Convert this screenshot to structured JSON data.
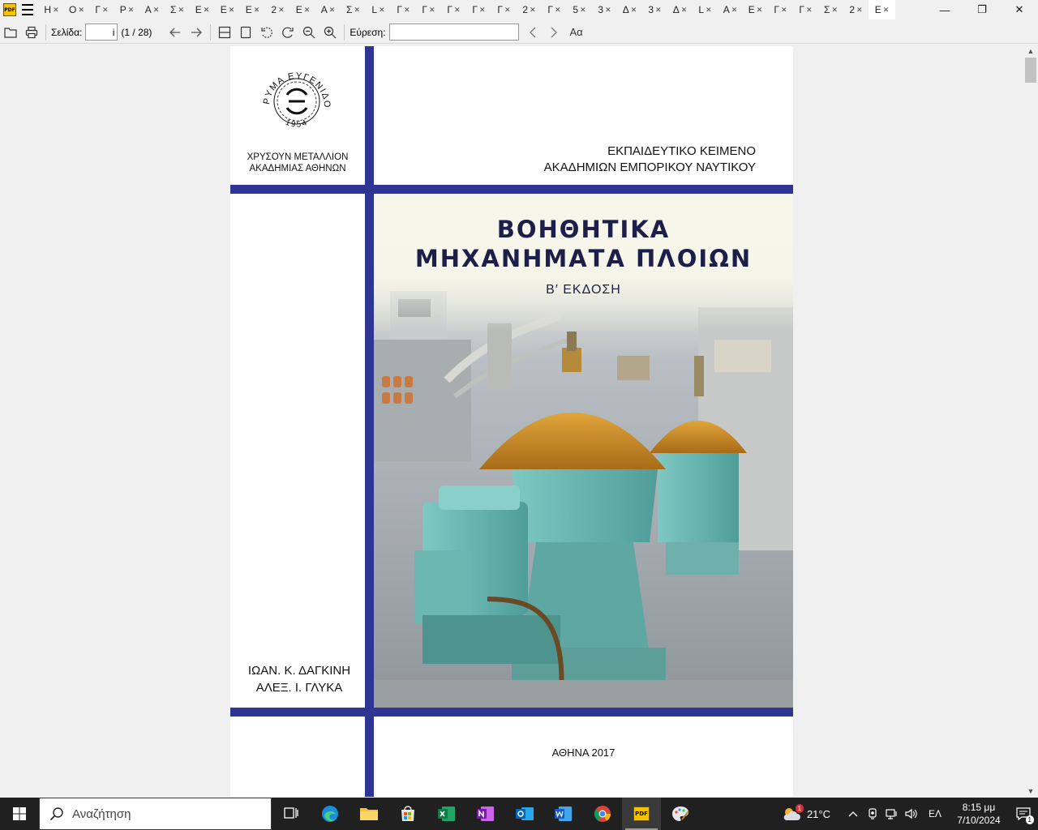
{
  "app": {
    "icon_text": "PDF",
    "tabs": [
      {
        "label": "Η"
      },
      {
        "label": "Ο"
      },
      {
        "label": "Γ"
      },
      {
        "label": "Ρ"
      },
      {
        "label": "Α"
      },
      {
        "label": "Σ"
      },
      {
        "label": "Ε"
      },
      {
        "label": "Ε"
      },
      {
        "label": "Ε"
      },
      {
        "label": "2"
      },
      {
        "label": "Ε"
      },
      {
        "label": "Α"
      },
      {
        "label": "Σ"
      },
      {
        "label": "L"
      },
      {
        "label": "Γ"
      },
      {
        "label": "Γ"
      },
      {
        "label": "Γ"
      },
      {
        "label": "Γ"
      },
      {
        "label": "Γ"
      },
      {
        "label": "2"
      },
      {
        "label": "Γ"
      },
      {
        "label": "5"
      },
      {
        "label": "3"
      },
      {
        "label": "Δ"
      },
      {
        "label": "3"
      },
      {
        "label": "Δ"
      },
      {
        "label": "L"
      },
      {
        "label": "Α"
      },
      {
        "label": "Ε"
      },
      {
        "label": "Γ"
      },
      {
        "label": "Γ"
      },
      {
        "label": "Σ"
      },
      {
        "label": "2"
      }
    ],
    "active_tab": {
      "label": "Ε"
    },
    "tab_close_glyph": "✕"
  },
  "window_controls": {
    "minimize": "—",
    "maximize": "❐",
    "close": "✕"
  },
  "toolbar": {
    "page_label": "Σελίδα:",
    "page_value": "i",
    "page_count": "(1 / 28)",
    "find_label": "Εύρεση:",
    "find_value": "",
    "case_label": "Aα"
  },
  "document": {
    "seal_text_top": "ΙΔΡΥΜΑ ΕΥΓΕΝΙΔΟΥ",
    "seal_year": "1954",
    "award_line1": "ΧΡΥΣΟΥΝ ΜΕΤΑΛΛΙΟΝ",
    "award_line2": "ΑΚΑΔΗΜΙΑΣ ΑΘΗΝΩΝ",
    "edu_line1": "ΕΚΠΑΙΔΕΥΤΙΚΟ ΚΕΙΜΕΝΟ",
    "edu_line2": "ΑΚΑΔΗΜΙΩΝ ΕΜΠΟΡΙΚΟΥ ΝΑΥΤΙΚΟΥ",
    "title_line1": "ΒΟΗΘΗΤΙΚΑ",
    "title_line2": "ΜΗΧΑΝΗΜΑΤΑ ΠΛΟΙΩΝ",
    "edition": "Β′ ΕΚΔΟΣΗ",
    "author1": "ΙΩΑΝ. Κ. ΔΑΓΚΙΝΗ",
    "author2": "ΑΛΕΞ. Ι. ΓΛΥΚΑ",
    "city_year": "ΑΘΗΝΑ 2017"
  },
  "taskbar": {
    "search_placeholder": "Αναζήτηση",
    "pdf_icon_text": "PDF",
    "weather_temp": "21°C",
    "weather_badge": "1",
    "language": "ΕΛ",
    "time": "8:15 μμ",
    "date": "7/10/2024",
    "notification_count": "1"
  },
  "colors": {
    "cover_blue": "#2f3592",
    "title_color": "#1d1f4a",
    "separator_teal": "#6fb9b4",
    "separator_gold": "#c8892a"
  }
}
